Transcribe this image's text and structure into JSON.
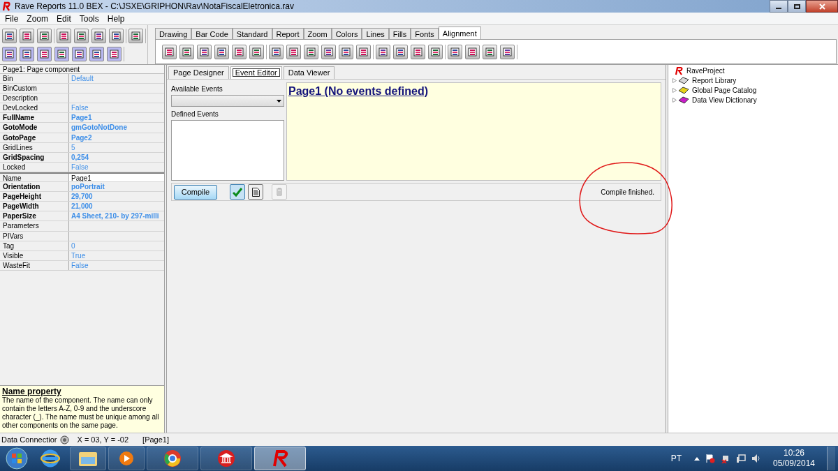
{
  "window": {
    "title": "Rave Reports 11.0 BEX - C:\\JSXE\\GRIPHON\\Rav\\NotaFiscalEletronica.rav"
  },
  "menu": [
    "File",
    "Zoom",
    "Edit",
    "Tools",
    "Help"
  ],
  "palette_tabs": [
    {
      "label": "Drawing",
      "selected": false
    },
    {
      "label": "Bar Code",
      "selected": false
    },
    {
      "label": "Standard",
      "selected": false
    },
    {
      "label": "Report",
      "selected": false
    },
    {
      "label": "Zoom",
      "selected": false
    },
    {
      "label": "Colors",
      "selected": false
    },
    {
      "label": "Lines",
      "selected": false
    },
    {
      "label": "Fills",
      "selected": false
    },
    {
      "label": "Fonts",
      "selected": false
    },
    {
      "label": "Alignment",
      "selected": true
    }
  ],
  "inspector": {
    "header": "Page1: Page component",
    "properties": [
      {
        "name": "Bin",
        "value": "Default",
        "bold": false,
        "selected": false
      },
      {
        "name": "BinCustom",
        "bold": false,
        "selected": false
      },
      {
        "name": "Description",
        "bold": false,
        "selected": false
      },
      {
        "name": "DevLocked",
        "value": "False",
        "bold": false,
        "selected": false
      },
      {
        "name": "FullName",
        "value": "Page1",
        "bold": true,
        "selected": false
      },
      {
        "name": "GotoMode",
        "value": "gmGotoNotDone",
        "bold": true,
        "selected": false
      },
      {
        "name": "GotoPage",
        "value": "Page2",
        "bold": true,
        "selected": false
      },
      {
        "name": "GridLines",
        "value": "5",
        "bold": false,
        "selected": false
      },
      {
        "name": "GridSpacing",
        "value": "0,254",
        "bold": true,
        "selected": false
      },
      {
        "name": "Locked",
        "value": "False",
        "bold": false,
        "selected": false
      },
      {
        "name": "Name",
        "value": "Page1",
        "bold": false,
        "selected": true
      },
      {
        "name": "Orientation",
        "value": "poPortrait",
        "bold": true,
        "selected": false
      },
      {
        "name": "PageHeight",
        "value": "29,700",
        "bold": true,
        "selected": false
      },
      {
        "name": "PageWidth",
        "value": "21,000",
        "bold": true,
        "selected": false
      },
      {
        "name": "PaperSize",
        "value": "A4 Sheet, 210- by 297-milli",
        "bold": true,
        "selected": false
      },
      {
        "name": "Parameters",
        "bold": false,
        "selected": false
      },
      {
        "name": "PIVars",
        "bold": false,
        "selected": false
      },
      {
        "name": "Tag",
        "value": "0",
        "bold": false,
        "selected": false
      },
      {
        "name": "Visible",
        "value": "True",
        "bold": false,
        "selected": false
      },
      {
        "name": "WasteFit",
        "value": "False",
        "bold": false,
        "selected": false
      }
    ],
    "help_title": "Name property",
    "help_text": "The name of the component. The name can only contain the letters A-Z, 0-9 and the underscore character (_).  The name must be unique among all other components on the same page."
  },
  "editor_tabs": [
    {
      "label": "Page Designer",
      "selected": false
    },
    {
      "label": "Event Editor",
      "selected": true
    },
    {
      "label": "Data Viewer",
      "selected": false
    }
  ],
  "event_editor": {
    "available_label": "Available Events",
    "defined_label": "Defined Events",
    "heading": "Page1 (No events defined)",
    "compile_button": "Compile",
    "status": "Compile finished."
  },
  "tree": [
    {
      "label": "RaveProject",
      "kind": "project",
      "children": [
        {
          "label": "Report Library",
          "kind": "library",
          "expanded": false
        },
        {
          "label": "Global Page Catalog",
          "kind": "catalog",
          "expanded": false
        },
        {
          "label": "Data View Dictionary",
          "kind": "dictionary",
          "expanded": false
        }
      ]
    }
  ],
  "status_bar": {
    "connection": "Data Connectior",
    "coords": "X = 03, Y = -02",
    "page": "[Page1]"
  },
  "taskbar": {
    "language": "PT",
    "time": "10:26",
    "date": "05/09/2014"
  }
}
